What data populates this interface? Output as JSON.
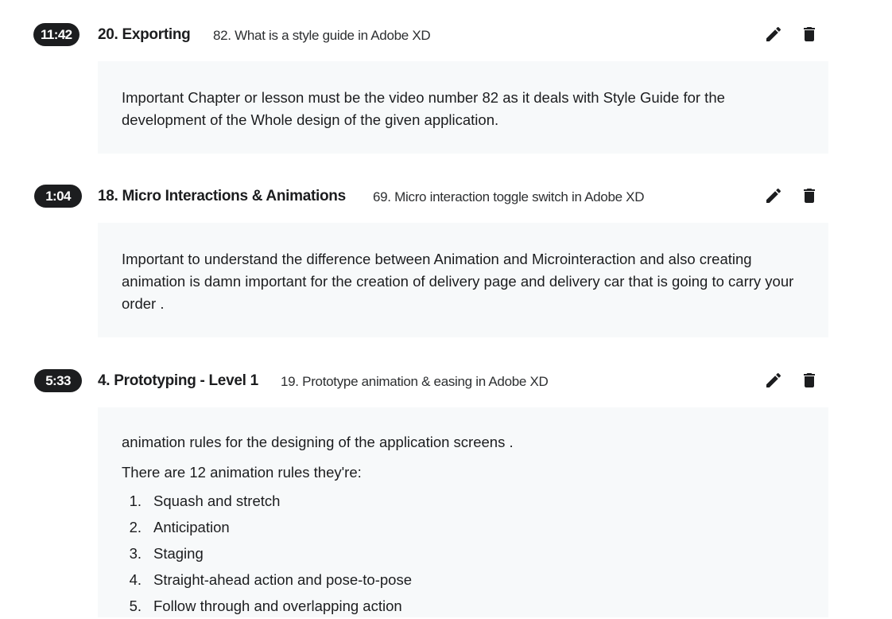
{
  "notes": [
    {
      "timestamp": "11:42",
      "chapter": "20. Exporting",
      "lecture": "82. What is a style guide in Adobe XD",
      "paragraphs": [
        "Important Chapter or lesson must be the video number 82 as it deals with Style Guide for the development of the Whole design of the given application."
      ]
    },
    {
      "timestamp": "1:04",
      "chapter": "18. Micro Interactions & Animations",
      "lecture": "69. Micro interaction toggle switch in Adobe XD",
      "paragraphs": [
        "Important to understand the difference between Animation and Microinteraction and also creating animation is damn important for the creation of delivery page and delivery car that is going to carry your order ."
      ]
    },
    {
      "timestamp": "5:33",
      "chapter": "4. Prototyping - Level 1",
      "lecture": "19. Prototype animation & easing in Adobe XD",
      "paragraphs": [
        "animation rules for the designing of the application screens .",
        "There are 12 animation rules they're:"
      ],
      "list": [
        {
          "num": "1.",
          "text": "Squash and stretch"
        },
        {
          "num": "2.",
          "text": "Anticipation"
        },
        {
          "num": "3.",
          "text": "Staging"
        },
        {
          "num": "4.",
          "text": "Straight-ahead action and pose-to-pose"
        },
        {
          "num": "5.",
          "text": "Follow through and overlapping action"
        }
      ]
    }
  ],
  "icons": {
    "edit": "pencil-icon",
    "delete": "trash-icon"
  }
}
